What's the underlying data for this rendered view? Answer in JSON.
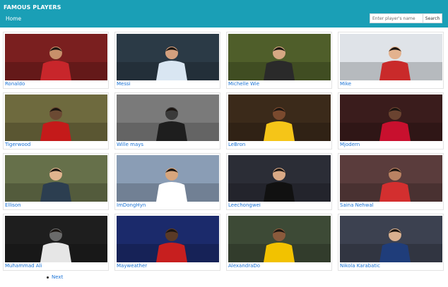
{
  "navbar": {
    "brand": "FAMOUS PLAYERS",
    "home_label": "Home",
    "search_placeholder": "Enter player's name",
    "search_button_label": "Search",
    "background_color": "#1a9fb6"
  },
  "players": [
    {
      "name": "Ronaldo",
      "bg": "#7a1f1f",
      "fg": "#c8262b",
      "skin": "#c78f6a"
    },
    {
      "name": "Messi",
      "bg": "#2b3a46",
      "fg": "#d9e6f2",
      "skin": "#d4a07e"
    },
    {
      "name": "Michelle Wie",
      "bg": "#4f5e2a",
      "fg": "#2a2a2a",
      "skin": "#d6a883"
    },
    {
      "name": "Mike",
      "bg": "#dfe3e8",
      "fg": "#c92a2a",
      "skin": "#e3b28e"
    },
    {
      "name": "Tigerwood",
      "bg": "#6e6a3e",
      "fg": "#c41a1a",
      "skin": "#6b4a33"
    },
    {
      "name": "Wille mays",
      "bg": "#7a7a7a",
      "fg": "#1e1e1e",
      "skin": "#3a3a3a"
    },
    {
      "name": "LeBron",
      "bg": "#3b2a1a",
      "fg": "#f5c518",
      "skin": "#7a4a2e"
    },
    {
      "name": "Mjodern",
      "bg": "#3a1c1c",
      "fg": "#c8102e",
      "skin": "#6a4330"
    },
    {
      "name": "Ellison",
      "bg": "#66704a",
      "fg": "#2c3e50",
      "skin": "#e0b48e"
    },
    {
      "name": "ImDongHyn",
      "bg": "#8a9db5",
      "fg": "#ffffff",
      "skin": "#d7a57c"
    },
    {
      "name": "Leechongwei",
      "bg": "#2b2d36",
      "fg": "#111111",
      "skin": "#d9a985"
    },
    {
      "name": "Saina Nehwal",
      "bg": "#5a3c3c",
      "fg": "#d32f2f",
      "skin": "#b98262"
    },
    {
      "name": "Muhammad Ali",
      "bg": "#1e1e1e",
      "fg": "#e6e6e6",
      "skin": "#6a6a6a"
    },
    {
      "name": "Mayweather",
      "bg": "#1b2a6b",
      "fg": "#c71f1f",
      "skin": "#5a3a26"
    },
    {
      "name": "AlexandraDo",
      "bg": "#3d4a36",
      "fg": "#f2c200",
      "skin": "#8a5a3c"
    },
    {
      "name": "Nikola Karabatic",
      "bg": "#3c4150",
      "fg": "#1f3d7a",
      "skin": "#d9b08f"
    }
  ],
  "pagination": {
    "next_label": "Next"
  }
}
